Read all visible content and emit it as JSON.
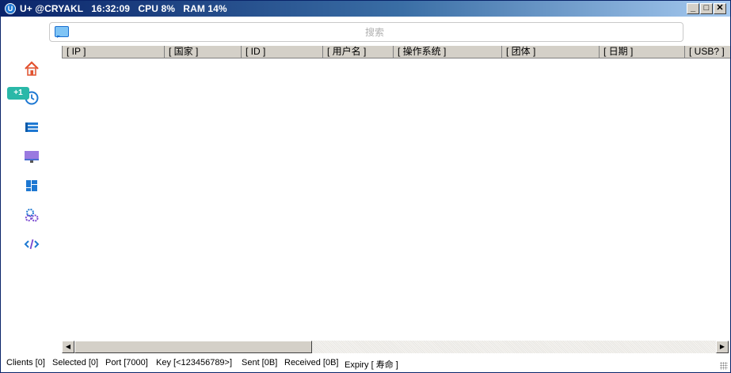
{
  "window": {
    "title": "U+ @CRYAKL   16:32:09   CPU 8%   RAM 14%",
    "app_icon": "u-plus-icon",
    "controls": [
      "minimize",
      "maximize",
      "close"
    ]
  },
  "search": {
    "placeholder": "搜索",
    "value": "",
    "icon": "chat-bubble-icon"
  },
  "table": {
    "columns": [
      "[ IP ]",
      "[ 国家 ]",
      "[ ID ]",
      "[ 用户名 ]",
      "[ 操作系统 ]",
      "[ 团体 ]",
      "[ 日期 ]",
      "[ USB? ]"
    ],
    "rows": []
  },
  "sidebar": {
    "items": [
      {
        "name": "home",
        "icon": "home-icon"
      },
      {
        "name": "history",
        "icon": "clock-history-icon",
        "badge": "+1"
      },
      {
        "name": "list",
        "icon": "list-icon"
      },
      {
        "name": "monitor",
        "icon": "monitor-icon"
      },
      {
        "name": "dashboard",
        "icon": "dashboard-icon"
      },
      {
        "name": "settings",
        "icon": "gears-icon"
      },
      {
        "name": "code",
        "icon": "code-icon"
      }
    ]
  },
  "status": {
    "clients": "Clients [0]",
    "selected": "Selected [0]",
    "port": "Port [7000]",
    "key": "Key [<123456789>]",
    "sent": "Sent [0B]",
    "received": "Received [0B]",
    "expiry": "Expiry [ 寿命 ]"
  },
  "colors": {
    "title_start": "#0a246a",
    "title_end": "#a6caf0",
    "accent": "#1e78d2",
    "badge": "#2ab8a8"
  }
}
